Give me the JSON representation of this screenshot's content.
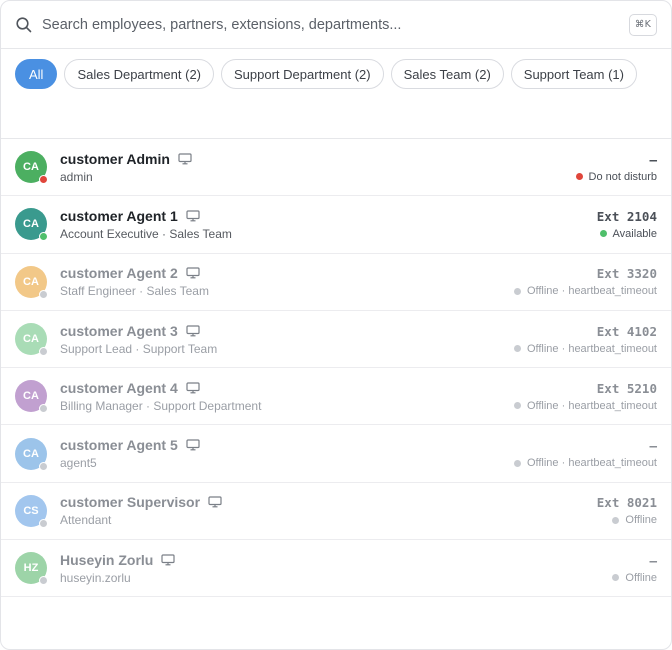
{
  "search": {
    "placeholder": "Search employees, partners, extensions, departments...",
    "shortcut": "⌘K"
  },
  "filters": [
    {
      "label": "All",
      "active": true
    },
    {
      "label": "Sales Department (2)",
      "active": false
    },
    {
      "label": "Support Department (2)",
      "active": false
    },
    {
      "label": "Sales Team (2)",
      "active": false
    },
    {
      "label": "Support Team (1)",
      "active": false
    }
  ],
  "colors": {
    "accent": "#4a90e2",
    "available": "#4fbf6b",
    "dnd": "#e0463b",
    "offline": "#c9ccd1"
  },
  "users": [
    {
      "initials": "CA",
      "name": "customer Admin",
      "sub": "admin",
      "ext": "–",
      "status": "Do not disturb",
      "presence": "dnd",
      "avatar_color": "#4caf61",
      "dim": false
    },
    {
      "initials": "CA",
      "name": "customer Agent 1",
      "sub": "Account Executive · Sales Team",
      "ext": "Ext 2104",
      "status": "Available",
      "presence": "available",
      "avatar_color": "#3a9a8e",
      "dim": false
    },
    {
      "initials": "CA",
      "name": "customer Agent 2",
      "sub": "Staff Engineer · Sales Team",
      "ext": "Ext 3320",
      "status": "Offline · heartbeat_timeout",
      "presence": "offline",
      "avatar_color": "#f2c888",
      "dim": true
    },
    {
      "initials": "CA",
      "name": "customer Agent 3",
      "sub": "Support Lead · Support Team",
      "ext": "Ext 4102",
      "status": "Offline · heartbeat_timeout",
      "presence": "offline",
      "avatar_color": "#a9dcb6",
      "dim": true
    },
    {
      "initials": "CA",
      "name": "customer Agent 4",
      "sub": "Billing Manager · Support Department",
      "ext": "Ext 5210",
      "status": "Offline · heartbeat_timeout",
      "presence": "offline",
      "avatar_color": "#c1a0d0",
      "dim": true
    },
    {
      "initials": "CA",
      "name": "customer Agent 5",
      "sub": "agent5",
      "ext": "–",
      "status": "Offline · heartbeat_timeout",
      "presence": "offline",
      "avatar_color": "#9cc4ea",
      "dim": true
    },
    {
      "initials": "CS",
      "name": "customer Supervisor",
      "sub": "Attendant",
      "ext": "Ext 8021",
      "status": "Offline",
      "presence": "offline",
      "avatar_color": "#a2c6ee",
      "dim": true
    },
    {
      "initials": "HZ",
      "name": "Huseyin Zorlu",
      "sub": "huseyin.zorlu",
      "ext": "–",
      "status": "Offline",
      "presence": "offline",
      "avatar_color": "#9dd4a8",
      "dim": true
    }
  ]
}
